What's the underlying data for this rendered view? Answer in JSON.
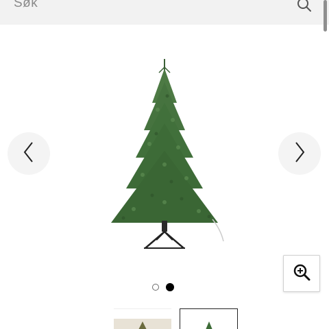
{
  "search": {
    "placeholder": "Søk",
    "icon": "search-icon"
  },
  "gallery": {
    "prev_icon": "chevron-left-icon",
    "next_icon": "chevron-right-icon",
    "zoom_icon": "zoom-in-icon",
    "total_images": 2,
    "current_index": 2,
    "thumbnails": [
      {
        "label": "thumbnail-1",
        "selected": false
      },
      {
        "label": "thumbnail-2",
        "selected": true
      }
    ]
  },
  "colors": {
    "search_bg": "#f2f2f2",
    "tree_green": "#3f6b3a",
    "dot_active": "#000000"
  }
}
